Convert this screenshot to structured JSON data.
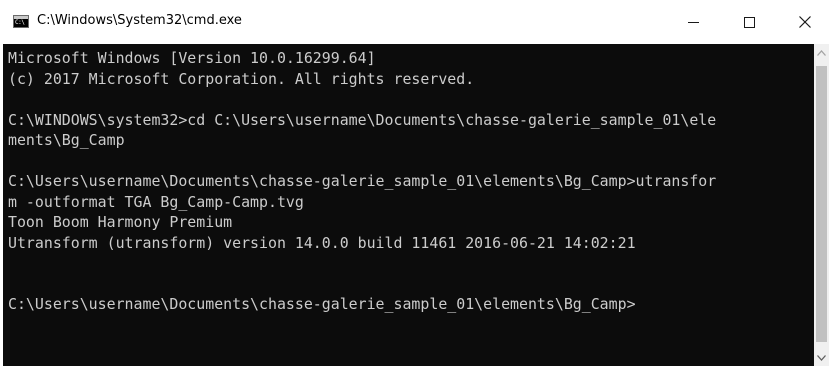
{
  "window": {
    "title": "C:\\Windows\\System32\\cmd.exe",
    "icon_text": "C:\\",
    "icon": "cmd-icon",
    "controls": {
      "minimize": "minimize-icon",
      "maximize": "maximize-icon",
      "close": "close-icon"
    }
  },
  "console": {
    "background": "#0c0c0c",
    "foreground": "#cccccc",
    "lines": [
      "Microsoft Windows [Version 10.0.16299.64]",
      "(c) 2017 Microsoft Corporation. All rights reserved.",
      "",
      "C:\\WINDOWS\\system32>cd C:\\Users\\username\\Documents\\chasse-galerie_sample_01\\ele",
      "ments\\Bg_Camp",
      "",
      "C:\\Users\\username\\Documents\\chasse-galerie_sample_01\\elements\\Bg_Camp>utransfor",
      "m -outformat TGA Bg_Camp-Camp.tvg",
      "Toon Boom Harmony Premium",
      "Utransform (utransform) version 14.0.0 build 11461 2016-06-21 14:02:21",
      "",
      "",
      "C:\\Users\\username\\Documents\\chasse-galerie_sample_01\\elements\\Bg_Camp>"
    ]
  },
  "scrollbar": {
    "up_icon": "scroll-up-arrow-icon",
    "down_icon": "scroll-down-arrow-icon"
  }
}
